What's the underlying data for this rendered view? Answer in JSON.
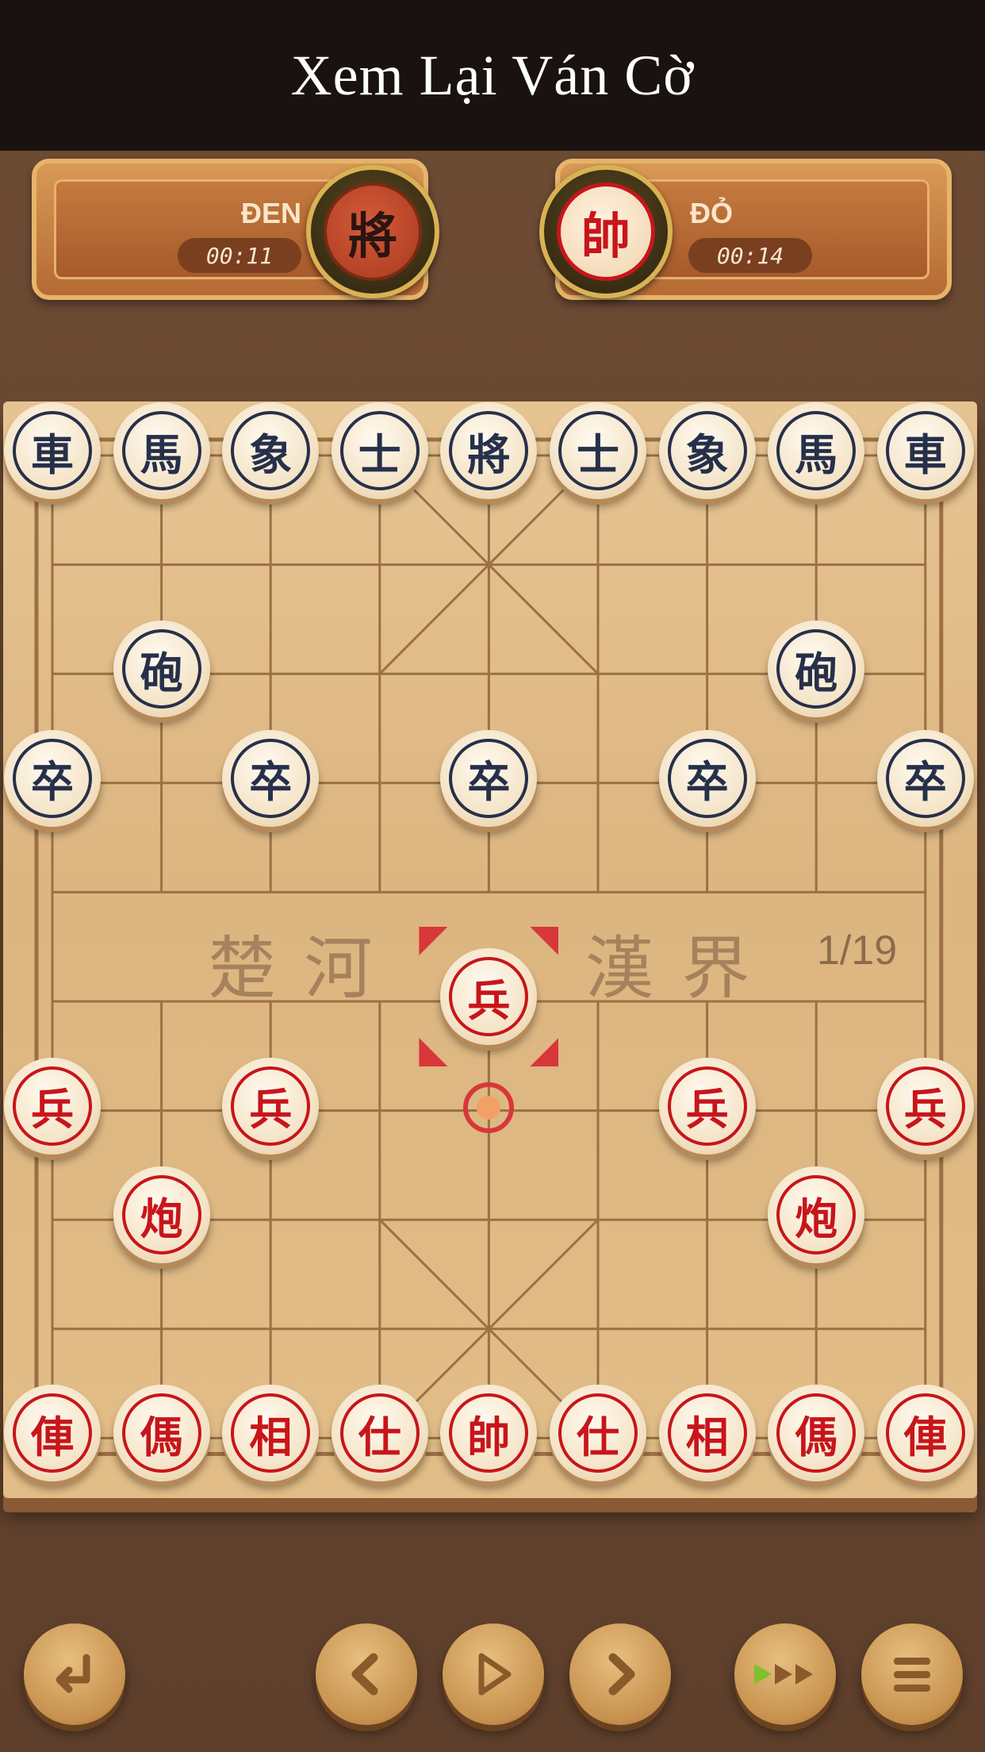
{
  "header": {
    "title": "Xem Lại Ván Cờ"
  },
  "players": {
    "black": {
      "label": "ĐEN",
      "time": "00:11",
      "avatar_char": "將"
    },
    "red": {
      "label": "ĐỎ",
      "time": "00:14",
      "avatar_char": "帥"
    }
  },
  "board": {
    "river_left": "楚 河",
    "river_right": "漢 界",
    "move_counter": "1/19",
    "pieces": [
      {
        "char": "車",
        "side": "black",
        "col": 0,
        "row": 0
      },
      {
        "char": "馬",
        "side": "black",
        "col": 1,
        "row": 0
      },
      {
        "char": "象",
        "side": "black",
        "col": 2,
        "row": 0
      },
      {
        "char": "士",
        "side": "black",
        "col": 3,
        "row": 0
      },
      {
        "char": "將",
        "side": "black",
        "col": 4,
        "row": 0
      },
      {
        "char": "士",
        "side": "black",
        "col": 5,
        "row": 0
      },
      {
        "char": "象",
        "side": "black",
        "col": 6,
        "row": 0
      },
      {
        "char": "馬",
        "side": "black",
        "col": 7,
        "row": 0
      },
      {
        "char": "車",
        "side": "black",
        "col": 8,
        "row": 0
      },
      {
        "char": "砲",
        "side": "black",
        "col": 1,
        "row": 2
      },
      {
        "char": "砲",
        "side": "black",
        "col": 7,
        "row": 2
      },
      {
        "char": "卒",
        "side": "black",
        "col": 0,
        "row": 3
      },
      {
        "char": "卒",
        "side": "black",
        "col": 2,
        "row": 3
      },
      {
        "char": "卒",
        "side": "black",
        "col": 4,
        "row": 3
      },
      {
        "char": "卒",
        "side": "black",
        "col": 6,
        "row": 3
      },
      {
        "char": "卒",
        "side": "black",
        "col": 8,
        "row": 3
      },
      {
        "char": "兵",
        "side": "red",
        "col": 4,
        "row": 5,
        "selected": true
      },
      {
        "char": "兵",
        "side": "red",
        "col": 0,
        "row": 6
      },
      {
        "char": "兵",
        "side": "red",
        "col": 2,
        "row": 6
      },
      {
        "char": "兵",
        "side": "red",
        "col": 6,
        "row": 6
      },
      {
        "char": "兵",
        "side": "red",
        "col": 8,
        "row": 6
      },
      {
        "char": "炮",
        "side": "red",
        "col": 1,
        "row": 7
      },
      {
        "char": "炮",
        "side": "red",
        "col": 7,
        "row": 7
      },
      {
        "char": "俥",
        "side": "red",
        "col": 0,
        "row": 9
      },
      {
        "char": "傌",
        "side": "red",
        "col": 1,
        "row": 9
      },
      {
        "char": "相",
        "side": "red",
        "col": 2,
        "row": 9
      },
      {
        "char": "仕",
        "side": "red",
        "col": 3,
        "row": 9
      },
      {
        "char": "帥",
        "side": "red",
        "col": 4,
        "row": 9
      },
      {
        "char": "仕",
        "side": "red",
        "col": 5,
        "row": 9
      },
      {
        "char": "相",
        "side": "red",
        "col": 6,
        "row": 9
      },
      {
        "char": "傌",
        "side": "red",
        "col": 7,
        "row": 9
      },
      {
        "char": "俥",
        "side": "red",
        "col": 8,
        "row": 9
      }
    ],
    "last_move_from": {
      "col": 4,
      "row": 6
    }
  },
  "controls": [
    {
      "name": "back-button",
      "icon": "return-arrow-icon"
    },
    {
      "name": "previous-move-button",
      "icon": "chevron-left-icon"
    },
    {
      "name": "play-button",
      "icon": "play-icon"
    },
    {
      "name": "next-move-button",
      "icon": "chevron-right-icon"
    },
    {
      "name": "fast-forward-button",
      "icon": "fast-forward-icon"
    },
    {
      "name": "menu-button",
      "icon": "hamburger-menu-icon"
    }
  ],
  "colors": {
    "red_piece": "#c8151b",
    "black_piece": "#27304a",
    "highlight": "#d8373a",
    "fast_forward_accent": "#7cc22a"
  }
}
